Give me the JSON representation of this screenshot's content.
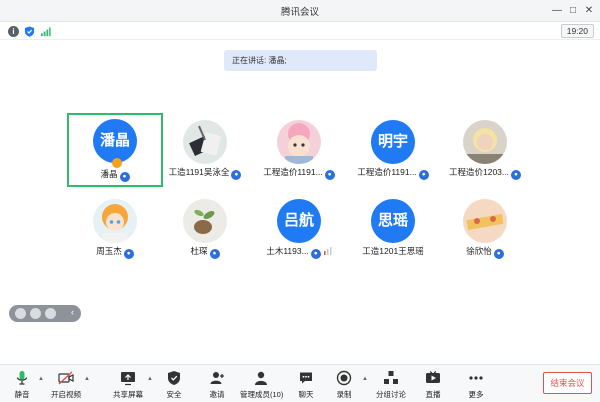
{
  "window": {
    "title": "腾讯会议"
  },
  "status": {
    "time": "19:20"
  },
  "speaking": {
    "text": "正在讲话: 潘晶;"
  },
  "participants": [
    {
      "name": "潘晶",
      "avatar_text": "潘晶"
    },
    {
      "name": "工造1191吴泳全"
    },
    {
      "name": "工程造价1191..."
    },
    {
      "name": "工程造价1191...",
      "avatar_text": "明宇"
    },
    {
      "name": "工程造价1203..."
    },
    {
      "name": "周玉杰"
    },
    {
      "name": "杜琛"
    },
    {
      "name": "土木1193...",
      "avatar_text": "吕航"
    },
    {
      "name": "工造1201王思瑶",
      "avatar_text": "思瑶"
    },
    {
      "name": "徐欣怡"
    }
  ],
  "toolbar": {
    "mute": "静音",
    "video": "开启视频",
    "share": "共享屏幕",
    "security": "安全",
    "invite": "邀请",
    "members": "管理成员(10)",
    "chat": "聊天",
    "record": "录制",
    "breakout": "分组讨论",
    "live": "直播",
    "more": "更多",
    "end": "结束会议"
  }
}
